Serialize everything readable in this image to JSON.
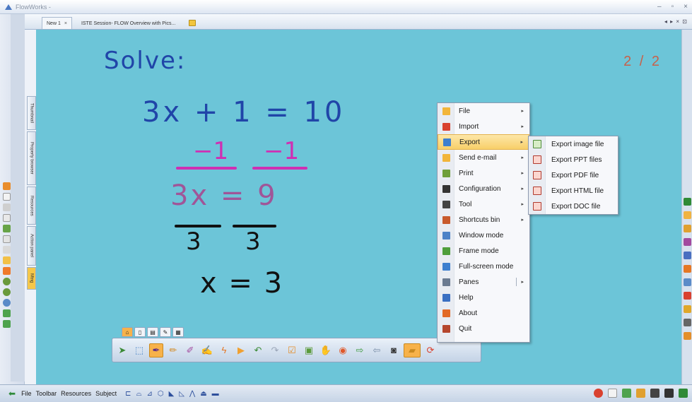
{
  "window": {
    "title": "FlowWorks -",
    "controls": [
      "–",
      "▫",
      "×"
    ]
  },
  "tabs": [
    {
      "label": "New 1",
      "close": "×"
    },
    {
      "label": "ISTE Session- FLOW Overview with Pics..."
    }
  ],
  "tab_nav": "◂ ▸ × ⊡",
  "side_tabs": [
    "Thumbnail",
    "Property browser",
    "Resources",
    "Action panel",
    "Mtng"
  ],
  "page_indicator": "2 / 2",
  "handwriting": {
    "solve": "Solve:",
    "eq1": "3x + 1 = 10",
    "minus_left": "−1",
    "minus_right": "−1",
    "eq2": "3x = 9",
    "denom_left": "3",
    "denom_right": "3",
    "result": "x = 3"
  },
  "menu": {
    "items": [
      {
        "label": "File",
        "icon": "folder-icon",
        "arrow": "▸",
        "color": "#f2b53a"
      },
      {
        "label": "Import",
        "icon": "import-icon",
        "arrow": "▸",
        "color": "#d9412f"
      },
      {
        "label": "Export",
        "icon": "export-icon",
        "arrow": "▸",
        "color": "#3d7fcf"
      },
      {
        "label": "Send e-mail",
        "icon": "email-icon",
        "arrow": "▸",
        "color": "#f2b53a"
      },
      {
        "label": "Print",
        "icon": "printer-icon",
        "arrow": "▸",
        "color": "#6f9f3a"
      },
      {
        "label": "Configuration",
        "icon": "gear-icon",
        "arrow": "▸",
        "color": "#333333"
      },
      {
        "label": "Tool",
        "icon": "tools-icon",
        "arrow": "▸",
        "color": "#444444"
      },
      {
        "label": "Shortcuts bin",
        "icon": "shortcuts-icon",
        "arrow": "▸",
        "color": "#c85a2c"
      },
      {
        "label": "Window mode",
        "icon": "window-icon",
        "arrow": "",
        "color": "#4c82c7"
      },
      {
        "label": "Frame mode",
        "icon": "frame-icon",
        "arrow": "",
        "color": "#4e9e3b"
      },
      {
        "label": "Full-screen mode",
        "icon": "fullscreen-icon",
        "arrow": "",
        "color": "#3d7fcf"
      },
      {
        "label": "Panes",
        "icon": "panes-icon",
        "arrow": "▸",
        "color": "#6b7a90"
      },
      {
        "label": "Help",
        "icon": "help-icon",
        "arrow": "",
        "color": "#3a6fc2"
      },
      {
        "label": "About",
        "icon": "about-icon",
        "arrow": "",
        "color": "#e26a26"
      },
      {
        "label": "Quit",
        "icon": "quit-icon",
        "arrow": "",
        "color": "#b5462d"
      }
    ]
  },
  "export_submenu": [
    {
      "label": "Export image file",
      "icon": "image-file-icon"
    },
    {
      "label": "Export PPT files",
      "icon": "ppt-file-icon"
    },
    {
      "label": "Export PDF file",
      "icon": "pdf-file-icon"
    },
    {
      "label": "Export HTML file",
      "icon": "html-file-icon"
    },
    {
      "label": "Export DOC file",
      "icon": "doc-file-icon"
    }
  ],
  "bottombar": {
    "items": [
      "File",
      "Toolbar",
      "Resources",
      "Subject"
    ],
    "icons": [
      "ruler-icon",
      "protractor-icon",
      "compass-icon",
      "cube-icon",
      "triangle-icon",
      "set-square-icon",
      "divider-icon",
      "shape-icon",
      "line-icon"
    ]
  },
  "colors": {
    "canvas": "#6cc5d8",
    "highlight": "#f8cf69",
    "blue_ink": "#2045a8",
    "pink_ink": "#cf2fb3",
    "purple_ink": "#a05598",
    "page_number": "#c8614a"
  }
}
